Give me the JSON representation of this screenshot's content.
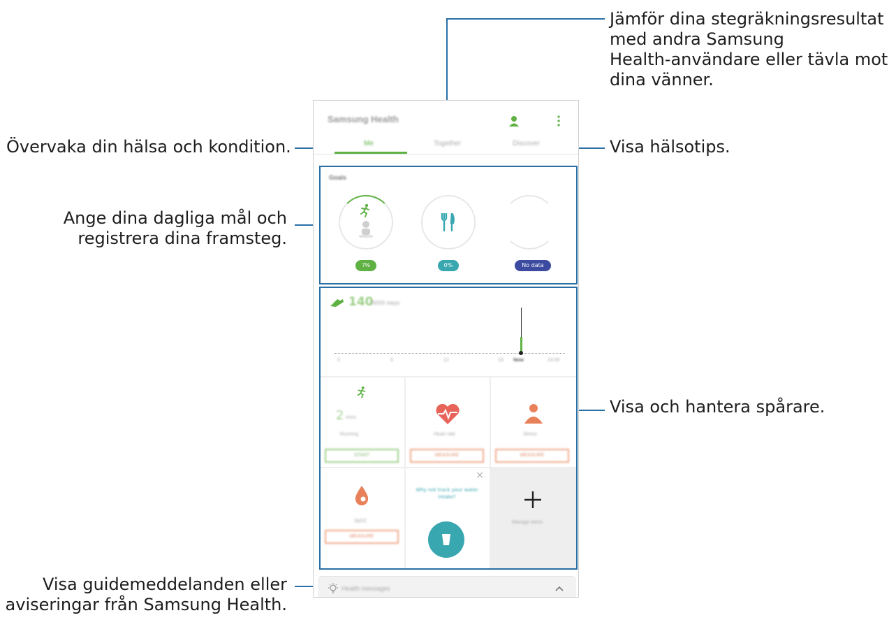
{
  "callouts": {
    "compare": [
      "Jämför dina stegräkningsresultat",
      "med andra Samsung",
      "Health-användare eller tävla mot",
      "dina vänner."
    ],
    "monitor": "Övervaka din hälsa och kondition.",
    "tips": "Visa hälsotips.",
    "goals": [
      "Ange dina dagliga mål och",
      "registrera dina framsteg."
    ],
    "trackers": "Visa och hantera spårare.",
    "messages": [
      "Visa guidemeddelanden eller",
      "aviseringar från Samsung Health."
    ]
  },
  "app": {
    "title": "Samsung Health",
    "tabs": [
      "Me",
      "Together",
      "Discover"
    ],
    "goals_title": "Goals",
    "goal_badges": [
      "7%",
      "0%",
      "No data"
    ],
    "steps_value": "140",
    "steps_unit": "/6000 steps",
    "chart_labels": [
      "0",
      "6",
      "12",
      "18",
      "Now",
      "24:00"
    ],
    "trackers": [
      {
        "value": "2",
        "unit": "mins",
        "label": "Running",
        "button": "START"
      },
      {
        "label": "Heart rate",
        "button": "MEASURE"
      },
      {
        "label": "Stress",
        "button": "MEASURE"
      },
      {
        "label": "SpO2",
        "button": "MEASURE"
      }
    ],
    "water_prompt": "Why not track your water intake?",
    "manage_label": "Manage items",
    "messages_label": "Health messages",
    "colors": {
      "accent": "#5fb144",
      "measure": "#e8805a",
      "sleep": "#3c4a9f",
      "water": "#39a7b0",
      "callout_line": "#2a6fa4"
    }
  }
}
